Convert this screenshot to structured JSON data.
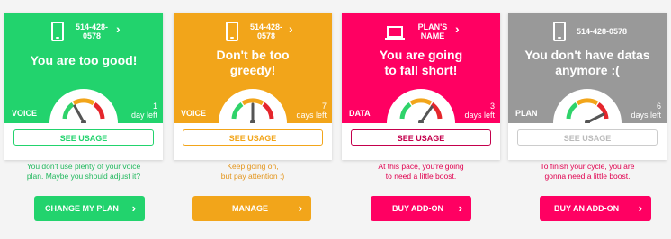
{
  "cards": [
    {
      "header_line": "514-428-\n0578",
      "message": "You are too good!",
      "type_label": "VOICE",
      "days_left": "1\nday left",
      "usage_label": "SEE USAGE",
      "advice": "You don't use plenty of your voice\nplan. Maybe you should adjust it?",
      "action_label": "CHANGE MY PLAN",
      "color": "#22d36d",
      "icon": "phone-icon",
      "gauge_level": 0.15
    },
    {
      "header_line": "514-428-\n0578",
      "message": "Don't be too\ngreedy!",
      "type_label": "VOICE",
      "days_left": "7\ndays left",
      "usage_label": "SEE USAGE",
      "advice": "Keep going on,\nbut pay attention :)",
      "action_label": "MANAGE",
      "color": "#f2a51a",
      "icon": "phone-icon",
      "gauge_level": 0.5
    },
    {
      "header_line": "PLAN'S\nNAME",
      "message": "You are going\nto fall short!",
      "type_label": "DATA",
      "days_left": "3\ndays left",
      "usage_label": "SEE USAGE",
      "advice": "At this pace, you're going\nto need a little boost.",
      "action_label": "BUY ADD-ON",
      "color": "#ff0062",
      "icon": "laptop-icon",
      "gauge_level": 0.85
    },
    {
      "header_line": "514-428-0578",
      "message": "You don't have datas\nanymore :(",
      "type_label": "PLAN",
      "days_left": "6\ndays left",
      "usage_label": "SEE USAGE",
      "advice": "To finish your cycle, you are\ngonna need a little boost.",
      "action_label": "BUY AN ADD-ON",
      "color_top": "#999999",
      "color_button": "#ff0062",
      "icon": "phone-icon",
      "gauge_level": 0.95
    }
  ]
}
